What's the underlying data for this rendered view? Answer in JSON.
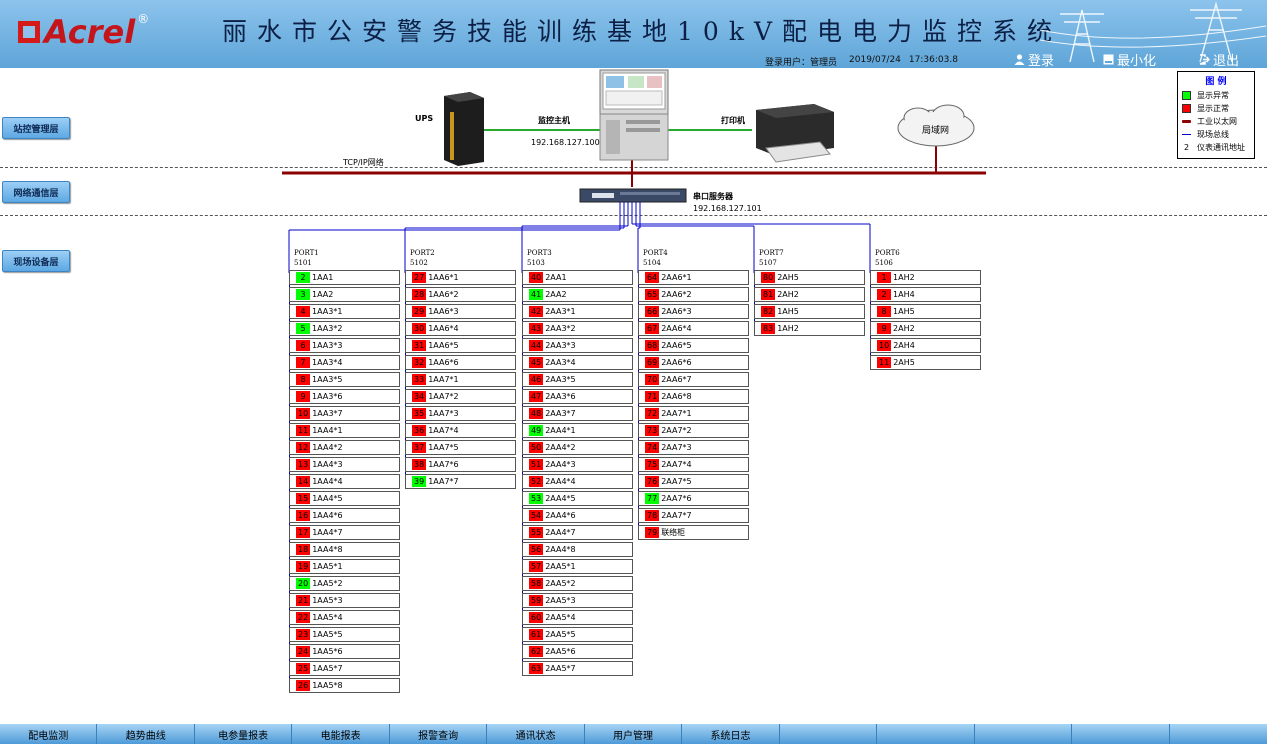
{
  "header": {
    "logo": "Acrel",
    "title": "丽水市公安警务技能训练基地10kV配电电力监控系统",
    "user_label": "登录用户：",
    "user_name": "管理员",
    "date": "2019/07/24",
    "time": "17:36:03.8",
    "login": "登录",
    "minimize": "最小化",
    "exit": "退出"
  },
  "layers": {
    "station": "站控管理层",
    "network": "网络通信层",
    "field": "现场设备层"
  },
  "devices": {
    "ups": "UPS",
    "host": "监控主机",
    "host_ip": "192.168.127.100",
    "printer": "打印机",
    "lan": "局域网",
    "tcpip": "TCP/IP网络",
    "serial": "串口服务器",
    "serial_ip": "192.168.127.101"
  },
  "legend": {
    "title": "图  例",
    "items": [
      {
        "label": "显示异常",
        "color": "#00ff00",
        "kind": "box"
      },
      {
        "label": "显示正常",
        "color": "#ff0000",
        "kind": "box"
      },
      {
        "label": "工业以太网",
        "color": "#8b0000",
        "kind": "thick"
      },
      {
        "label": "现场总线",
        "color": "#0000cc",
        "kind": "thin"
      },
      {
        "label": "仪表通讯地址",
        "symbol": "2",
        "kind": "text"
      }
    ]
  },
  "colors": {
    "ok": "#00ff00",
    "alarm": "#ff0000",
    "ethernet": "#8b0000",
    "fieldbus": "#0000cc"
  },
  "ports": [
    {
      "name": "PORT1",
      "code": "5101",
      "items": [
        {
          "n": "2",
          "name": "1AA1",
          "s": "g"
        },
        {
          "n": "3",
          "name": "1AA2",
          "s": "g"
        },
        {
          "n": "4",
          "name": "1AA3*1",
          "s": "r"
        },
        {
          "n": "5",
          "name": "1AA3*2",
          "s": "g"
        },
        {
          "n": "6",
          "name": "1AA3*3",
          "s": "r"
        },
        {
          "n": "7",
          "name": "1AA3*4",
          "s": "r"
        },
        {
          "n": "8",
          "name": "1AA3*5",
          "s": "r"
        },
        {
          "n": "9",
          "name": "1AA3*6",
          "s": "r"
        },
        {
          "n": "10",
          "name": "1AA3*7",
          "s": "r"
        },
        {
          "n": "11",
          "name": "1AA4*1",
          "s": "r"
        },
        {
          "n": "12",
          "name": "1AA4*2",
          "s": "r"
        },
        {
          "n": "13",
          "name": "1AA4*3",
          "s": "r"
        },
        {
          "n": "14",
          "name": "1AA4*4",
          "s": "r"
        },
        {
          "n": "15",
          "name": "1AA4*5",
          "s": "r"
        },
        {
          "n": "16",
          "name": "1AA4*6",
          "s": "r"
        },
        {
          "n": "17",
          "name": "1AA4*7",
          "s": "r"
        },
        {
          "n": "18",
          "name": "1AA4*8",
          "s": "r"
        },
        {
          "n": "19",
          "name": "1AA5*1",
          "s": "r"
        },
        {
          "n": "20",
          "name": "1AA5*2",
          "s": "g"
        },
        {
          "n": "21",
          "name": "1AA5*3",
          "s": "r"
        },
        {
          "n": "22",
          "name": "1AA5*4",
          "s": "r"
        },
        {
          "n": "23",
          "name": "1AA5*5",
          "s": "r"
        },
        {
          "n": "24",
          "name": "1AA5*6",
          "s": "r"
        },
        {
          "n": "25",
          "name": "1AA5*7",
          "s": "r"
        },
        {
          "n": "26",
          "name": "1AA5*8",
          "s": "r"
        }
      ]
    },
    {
      "name": "PORT2",
      "code": "5102",
      "items": [
        {
          "n": "27",
          "name": "1AA6*1",
          "s": "r"
        },
        {
          "n": "28",
          "name": "1AA6*2",
          "s": "r"
        },
        {
          "n": "29",
          "name": "1AA6*3",
          "s": "r"
        },
        {
          "n": "30",
          "name": "1AA6*4",
          "s": "r"
        },
        {
          "n": "31",
          "name": "1AA6*5",
          "s": "r"
        },
        {
          "n": "32",
          "name": "1AA6*6",
          "s": "r"
        },
        {
          "n": "33",
          "name": "1AA7*1",
          "s": "r"
        },
        {
          "n": "34",
          "name": "1AA7*2",
          "s": "r"
        },
        {
          "n": "35",
          "name": "1AA7*3",
          "s": "r"
        },
        {
          "n": "36",
          "name": "1AA7*4",
          "s": "r"
        },
        {
          "n": "37",
          "name": "1AA7*5",
          "s": "r"
        },
        {
          "n": "38",
          "name": "1AA7*6",
          "s": "r"
        },
        {
          "n": "39",
          "name": "1AA7*7",
          "s": "g"
        }
      ]
    },
    {
      "name": "PORT3",
      "code": "5103",
      "items": [
        {
          "n": "40",
          "name": "2AA1",
          "s": "r"
        },
        {
          "n": "41",
          "name": "2AA2",
          "s": "g"
        },
        {
          "n": "42",
          "name": "2AA3*1",
          "s": "r"
        },
        {
          "n": "43",
          "name": "2AA3*2",
          "s": "r"
        },
        {
          "n": "44",
          "name": "2AA3*3",
          "s": "r"
        },
        {
          "n": "45",
          "name": "2AA3*4",
          "s": "r"
        },
        {
          "n": "46",
          "name": "2AA3*5",
          "s": "r"
        },
        {
          "n": "47",
          "name": "2AA3*6",
          "s": "r"
        },
        {
          "n": "48",
          "name": "2AA3*7",
          "s": "r"
        },
        {
          "n": "49",
          "name": "2AA4*1",
          "s": "g"
        },
        {
          "n": "50",
          "name": "2AA4*2",
          "s": "r"
        },
        {
          "n": "51",
          "name": "2AA4*3",
          "s": "r"
        },
        {
          "n": "52",
          "name": "2AA4*4",
          "s": "r"
        },
        {
          "n": "53",
          "name": "2AA4*5",
          "s": "g"
        },
        {
          "n": "54",
          "name": "2AA4*6",
          "s": "r"
        },
        {
          "n": "55",
          "name": "2AA4*7",
          "s": "r"
        },
        {
          "n": "56",
          "name": "2AA4*8",
          "s": "r"
        },
        {
          "n": "57",
          "name": "2AA5*1",
          "s": "r"
        },
        {
          "n": "58",
          "name": "2AA5*2",
          "s": "r"
        },
        {
          "n": "59",
          "name": "2AA5*3",
          "s": "r"
        },
        {
          "n": "60",
          "name": "2AA5*4",
          "s": "r"
        },
        {
          "n": "61",
          "name": "2AA5*5",
          "s": "r"
        },
        {
          "n": "62",
          "name": "2AA5*6",
          "s": "r"
        },
        {
          "n": "63",
          "name": "2AA5*7",
          "s": "r"
        }
      ]
    },
    {
      "name": "PORT4",
      "code": "5104",
      "items": [
        {
          "n": "64",
          "name": "2AA6*1",
          "s": "r"
        },
        {
          "n": "65",
          "name": "2AA6*2",
          "s": "r"
        },
        {
          "n": "66",
          "name": "2AA6*3",
          "s": "r"
        },
        {
          "n": "67",
          "name": "2AA6*4",
          "s": "r"
        },
        {
          "n": "68",
          "name": "2AA6*5",
          "s": "r"
        },
        {
          "n": "69",
          "name": "2AA6*6",
          "s": "r"
        },
        {
          "n": "70",
          "name": "2AA6*7",
          "s": "r"
        },
        {
          "n": "71",
          "name": "2AA6*8",
          "s": "r"
        },
        {
          "n": "72",
          "name": "2AA7*1",
          "s": "r"
        },
        {
          "n": "73",
          "name": "2AA7*2",
          "s": "r"
        },
        {
          "n": "74",
          "name": "2AA7*3",
          "s": "r"
        },
        {
          "n": "75",
          "name": "2AA7*4",
          "s": "r"
        },
        {
          "n": "76",
          "name": "2AA7*5",
          "s": "r"
        },
        {
          "n": "77",
          "name": "2AA7*6",
          "s": "g"
        },
        {
          "n": "78",
          "name": "2AA7*7",
          "s": "r"
        },
        {
          "n": "79",
          "name": "联络柜",
          "s": "r"
        }
      ]
    },
    {
      "name": "PORT7",
      "code": "5107",
      "items": [
        {
          "n": "80",
          "name": "2AH5",
          "s": "r"
        },
        {
          "n": "81",
          "name": "2AH2",
          "s": "r"
        },
        {
          "n": "82",
          "name": "1AH5",
          "s": "r"
        },
        {
          "n": "83",
          "name": "1AH2",
          "s": "r"
        }
      ]
    },
    {
      "name": "PORT6",
      "code": "5106",
      "items": [
        {
          "n": "1",
          "name": "1AH2",
          "s": "r"
        },
        {
          "n": "2",
          "name": "1AH4",
          "s": "r"
        },
        {
          "n": "8",
          "name": "1AH5",
          "s": "r"
        },
        {
          "n": "9",
          "name": "2AH2",
          "s": "r"
        },
        {
          "n": "10",
          "name": "2AH4",
          "s": "r"
        },
        {
          "n": "11",
          "name": "2AH5",
          "s": "r"
        }
      ]
    }
  ],
  "footer_tabs": [
    "配电监测",
    "趋势曲线",
    "电参量报表",
    "电能报表",
    "报警查询",
    "通讯状态",
    "用户管理",
    "系统日志",
    "",
    "",
    "",
    "",
    ""
  ]
}
